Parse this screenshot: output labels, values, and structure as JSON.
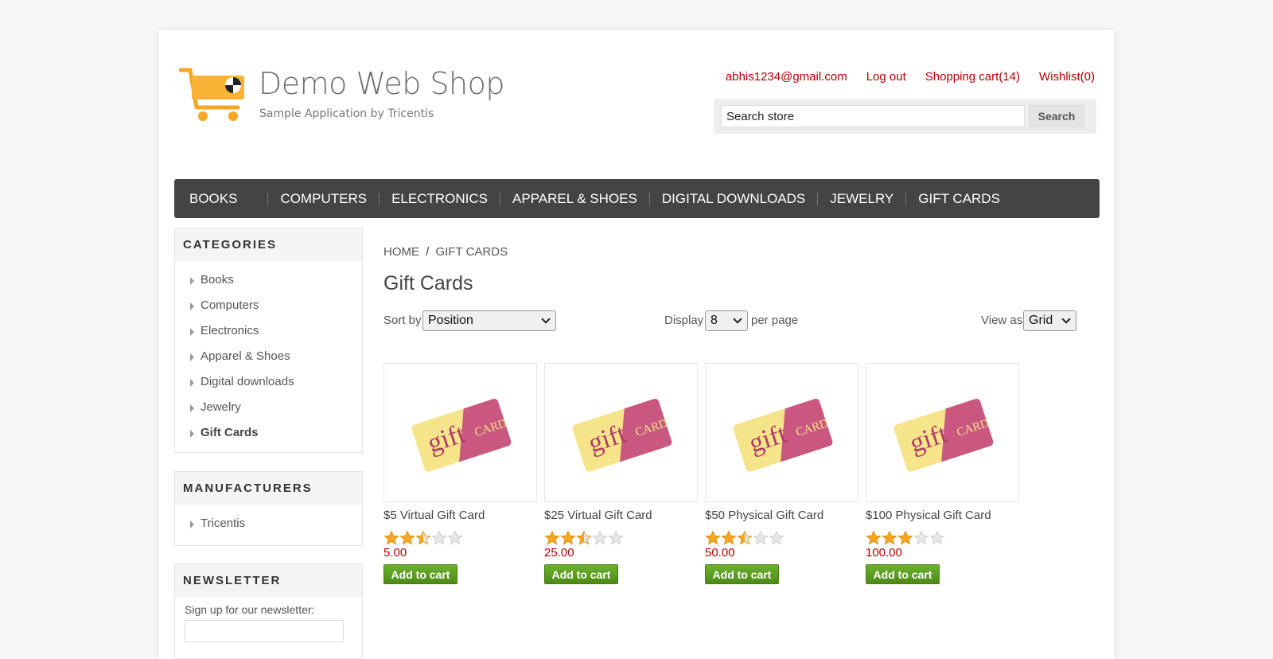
{
  "header": {
    "logo_title": "Demo Web Shop",
    "logo_subtitle": "Sample Application by Tricentis",
    "links": {
      "account": "abhis1234@gmail.com",
      "logout": "Log out",
      "cart": "Shopping cart(14)",
      "wishlist": "Wishlist(0)"
    },
    "search": {
      "value": "Search store",
      "button": "Search"
    }
  },
  "topmenu": [
    "BOOKS",
    "COMPUTERS",
    "ELECTRONICS",
    "APPAREL & SHOES",
    "DIGITAL DOWNLOADS",
    "JEWELRY",
    "GIFT CARDS"
  ],
  "categories": {
    "title": "CATEGORIES",
    "items": [
      "Books",
      "Computers",
      "Electronics",
      "Apparel & Shoes",
      "Digital downloads",
      "Jewelry",
      "Gift Cards"
    ],
    "active": "Gift Cards"
  },
  "manufacturers": {
    "title": "MANUFACTURERS",
    "items": [
      "Tricentis"
    ]
  },
  "newsletter": {
    "title": "NEWSLETTER",
    "text": "Sign up for our newsletter:"
  },
  "breadcrumb": {
    "home": "HOME",
    "sep": "/",
    "current": "GIFT CARDS"
  },
  "page_title": "Gift Cards",
  "controls": {
    "sort_label": "Sort by",
    "sort_value": "Position",
    "display_label": "Display",
    "display_value": "8",
    "per_page": "per page",
    "view_label": "View as",
    "view_value": "Grid"
  },
  "image_text": {
    "gift": "gift",
    "card": "CARD"
  },
  "products": [
    {
      "name": "$5 Virtual Gift Card",
      "price": "5.00",
      "rating": 2.5,
      "button": "Add to cart"
    },
    {
      "name": "$25 Virtual Gift Card",
      "price": "25.00",
      "rating": 2.5,
      "button": "Add to cart"
    },
    {
      "name": "$50 Physical Gift Card",
      "price": "50.00",
      "rating": 2.5,
      "button": "Add to cart"
    },
    {
      "name": "$100 Physical Gift Card",
      "price": "100.00",
      "rating": 3,
      "button": "Add to cart"
    }
  ],
  "colors": {
    "accent_red": "#b40000",
    "menu_bg": "#444444",
    "button_green": "#5a9e20",
    "star": "#f5a623"
  }
}
